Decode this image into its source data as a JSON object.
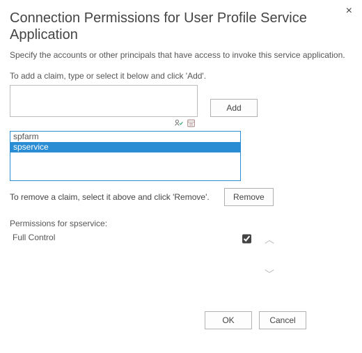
{
  "dialog": {
    "title": "Connection Permissions for User Profile Service Application",
    "description": "Specify the accounts or other principals that have access to invoke this service application.",
    "add_instruction": "To add a claim, type or select it below and click 'Add'.",
    "add_button": "Add",
    "claims_list": [
      {
        "name": "spfarm",
        "selected": false
      },
      {
        "name": "spservice",
        "selected": true
      }
    ],
    "remove_instruction": "To remove a claim, select it above and click 'Remove'.",
    "remove_button": "Remove",
    "permissions_label": "Permissions for spservice:",
    "permissions": [
      {
        "label": "Full Control",
        "checked": true
      }
    ],
    "ok_button": "OK",
    "cancel_button": "Cancel",
    "claim_input_value": ""
  },
  "icons": {
    "check_names": "check-names-icon",
    "browse": "browse-icon"
  }
}
